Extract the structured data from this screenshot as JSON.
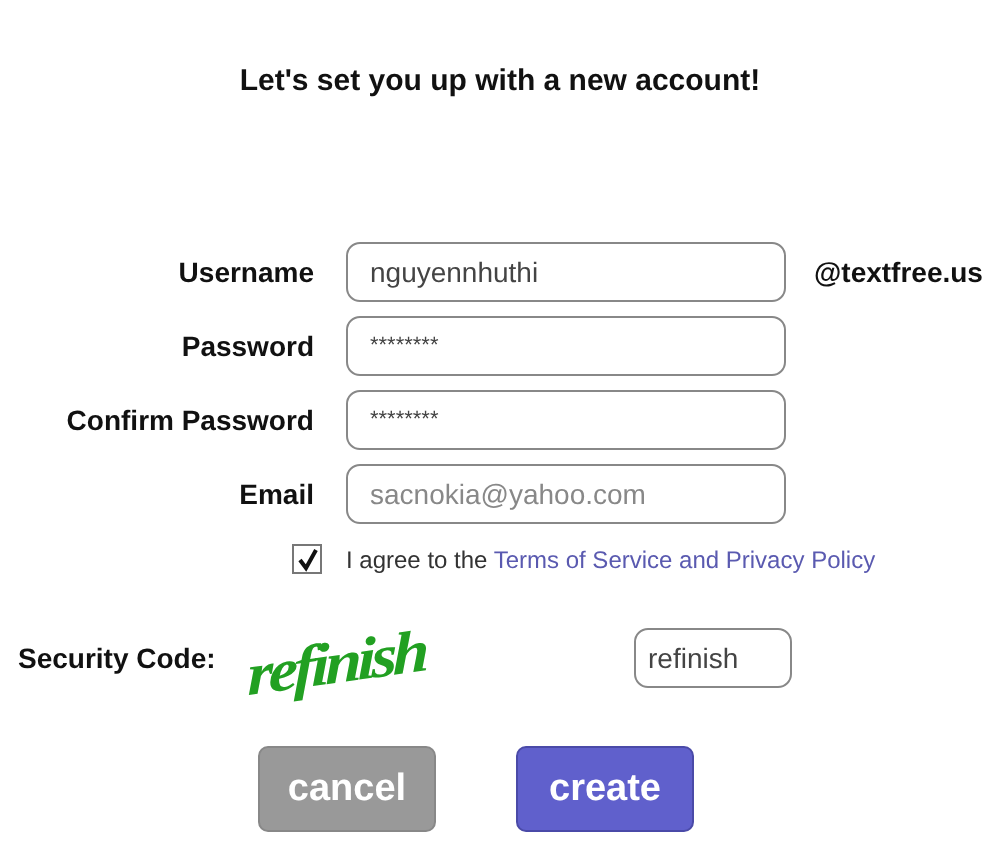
{
  "title": "Let's set you up with a new account!",
  "fields": [
    {
      "label": "Username",
      "value": "nguyennhuthi",
      "suffix": "@textfree.us",
      "kind": "text"
    },
    {
      "label": "Password",
      "value": "********",
      "kind": "secret"
    },
    {
      "label": "Confirm Password",
      "value": "********",
      "kind": "secret"
    },
    {
      "label": "Email",
      "value": "sacnokia@yahoo.com",
      "kind": "blurred"
    }
  ],
  "agree": {
    "checked": true,
    "text": "I agree to the ",
    "link": "Terms of Service and Privacy Policy"
  },
  "security": {
    "label": "Security Code:",
    "captcha_text": "refinish",
    "value": "refinish"
  },
  "buttons": [
    {
      "label": "cancel",
      "kind": "secondary"
    },
    {
      "label": "create",
      "kind": "primary"
    }
  ]
}
